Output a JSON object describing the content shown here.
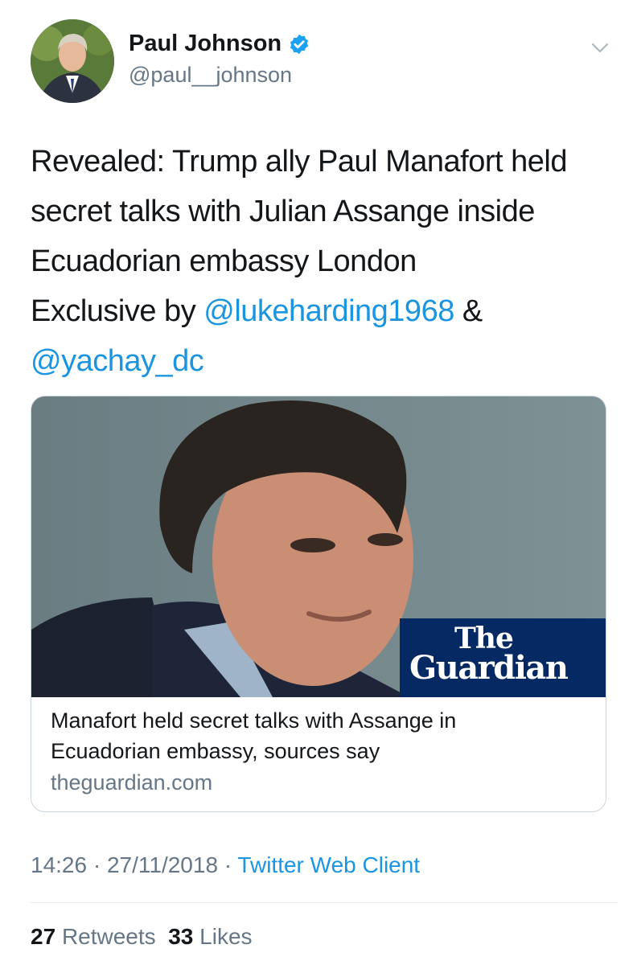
{
  "author": {
    "name": "Paul Johnson",
    "handle": "@paul__johnson",
    "verified_icon": "verified-badge-icon",
    "menu_icon": "chevron-down-icon"
  },
  "tweet": {
    "text_line1": "Revealed: Trump ally Paul Manafort held",
    "text_line2": "secret talks with Julian Assange inside",
    "text_line3": "Ecuadorian embassy London",
    "text_line4_prefix": "Exclusive by ",
    "mention1": "@lukeharding1968",
    "text_line4_suffix": " &",
    "mention2": "@yachay_dc"
  },
  "card": {
    "logo_the": "The",
    "logo_guardian": "Guardian",
    "title_line1": "Manafort held secret talks with Assange in",
    "title_line2": "Ecuadorian embassy, sources say",
    "domain": "theguardian.com"
  },
  "meta": {
    "time": "14:26",
    "separator1": " · ",
    "date": "27/11/2018",
    "separator2": " · ",
    "client": "Twitter Web Client"
  },
  "stats": {
    "retweets_count": "27",
    "retweets_label": "Retweets",
    "likes_count": "33",
    "likes_label": "Likes"
  },
  "colors": {
    "link": "#1b95e0",
    "secondary": "#657786",
    "guardian_blue": "#052962"
  }
}
